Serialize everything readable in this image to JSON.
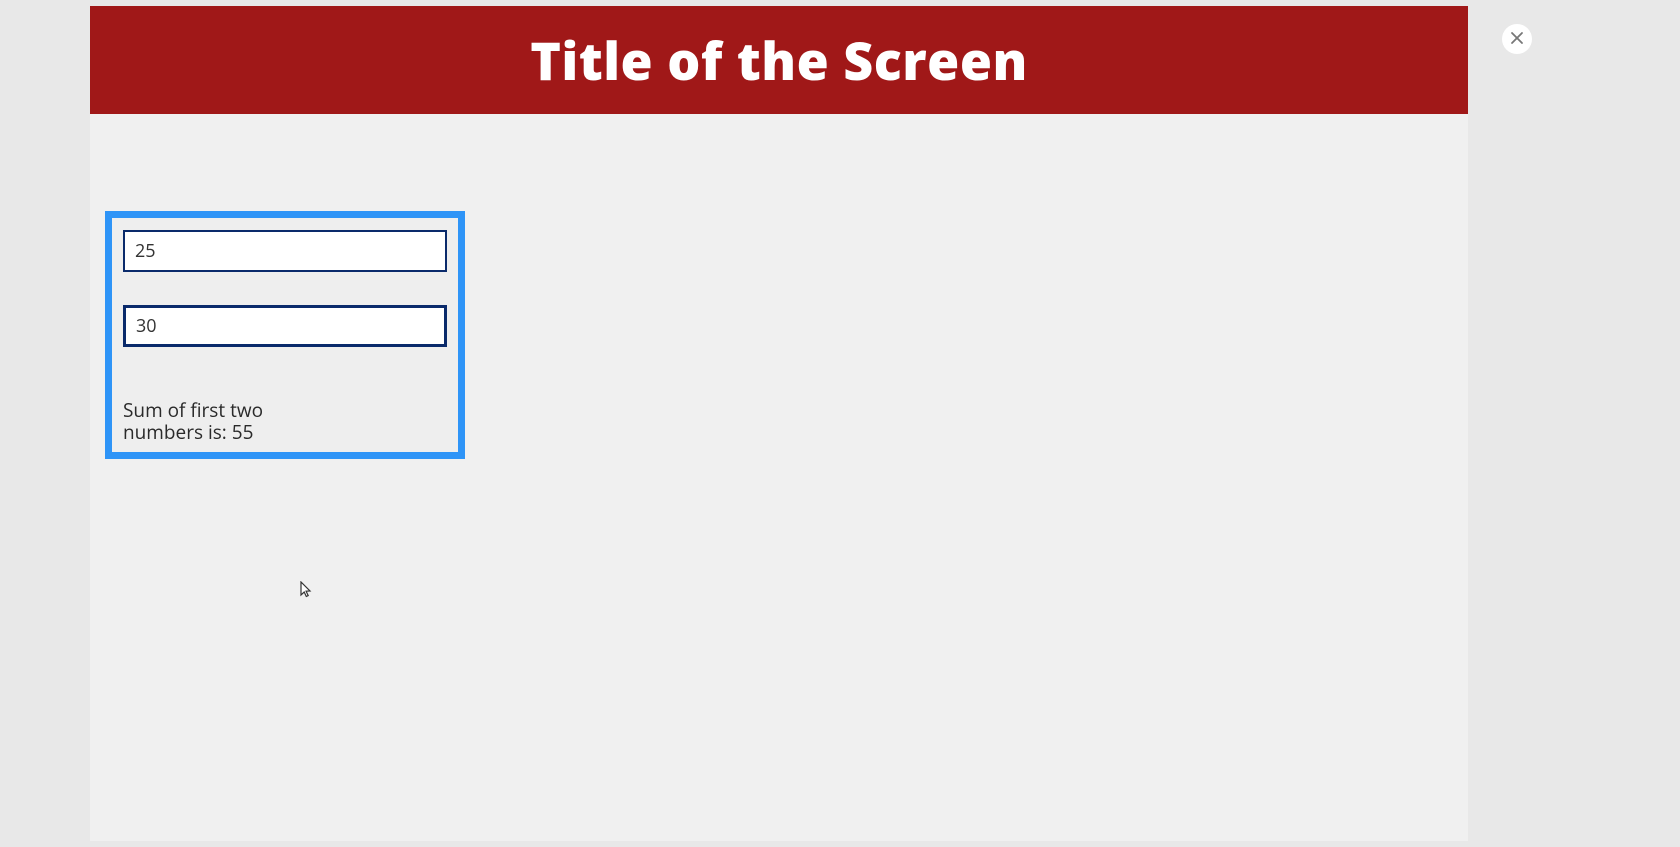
{
  "header": {
    "title": "Title of the Screen"
  },
  "form": {
    "input1_value": "25",
    "input2_value": "30",
    "result_text": "Sum of first two numbers is: 55"
  },
  "colors": {
    "header_bg": "#a01818",
    "card_border": "#2e94f7",
    "input_border": "#0a2a6b"
  },
  "close_icon": "close"
}
